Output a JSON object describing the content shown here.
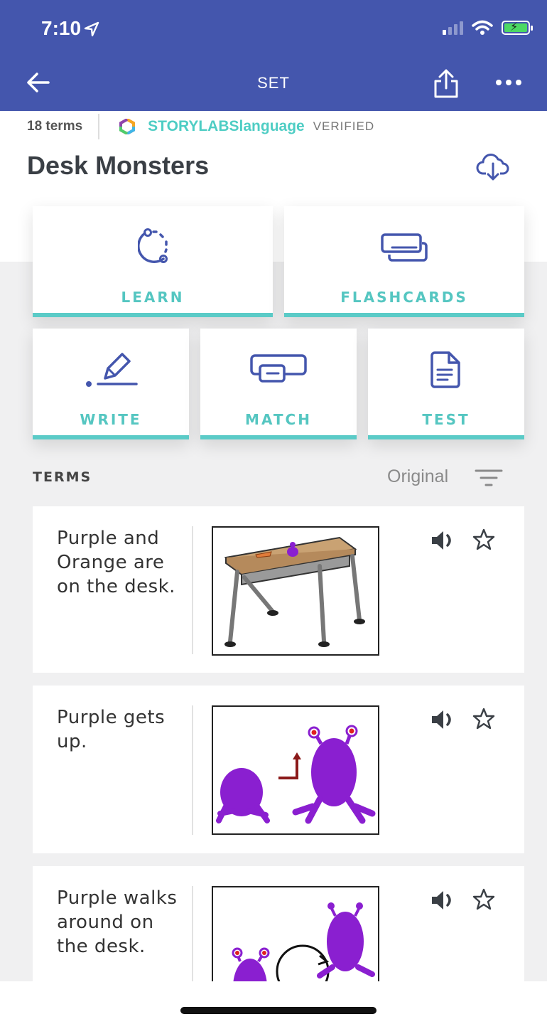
{
  "status_bar": {
    "time": "7:10"
  },
  "nav": {
    "title": "SET"
  },
  "set_info": {
    "term_count": "18 terms",
    "creator": "STORYLABSlanguage",
    "verified": "VERIFIED",
    "title": "Desk Monsters"
  },
  "modes": [
    {
      "label": "LEARN",
      "icon": "learn-loop-icon"
    },
    {
      "label": "FLASHCARDS",
      "icon": "flashcards-icon"
    },
    {
      "label": "WRITE",
      "icon": "write-pen-icon"
    },
    {
      "label": "MATCH",
      "icon": "match-icon"
    },
    {
      "label": "TEST",
      "icon": "test-document-icon"
    }
  ],
  "terms_section": {
    "heading": "TERMS",
    "sort_order": "Original"
  },
  "terms": [
    {
      "text": "Purple and Orange are on the desk.",
      "image": "desk-with-monsters"
    },
    {
      "text": "Purple gets up.",
      "image": "purple-monster-stands-up"
    },
    {
      "text": "Purple walks around on the desk.",
      "image": "purple-monster-walks-around"
    }
  ],
  "colors": {
    "nav_bg": "#4456ad",
    "accent_teal": "#5bcbc7",
    "icon_blue": "#4456ad",
    "monster_purple": "#8a1fd0"
  }
}
